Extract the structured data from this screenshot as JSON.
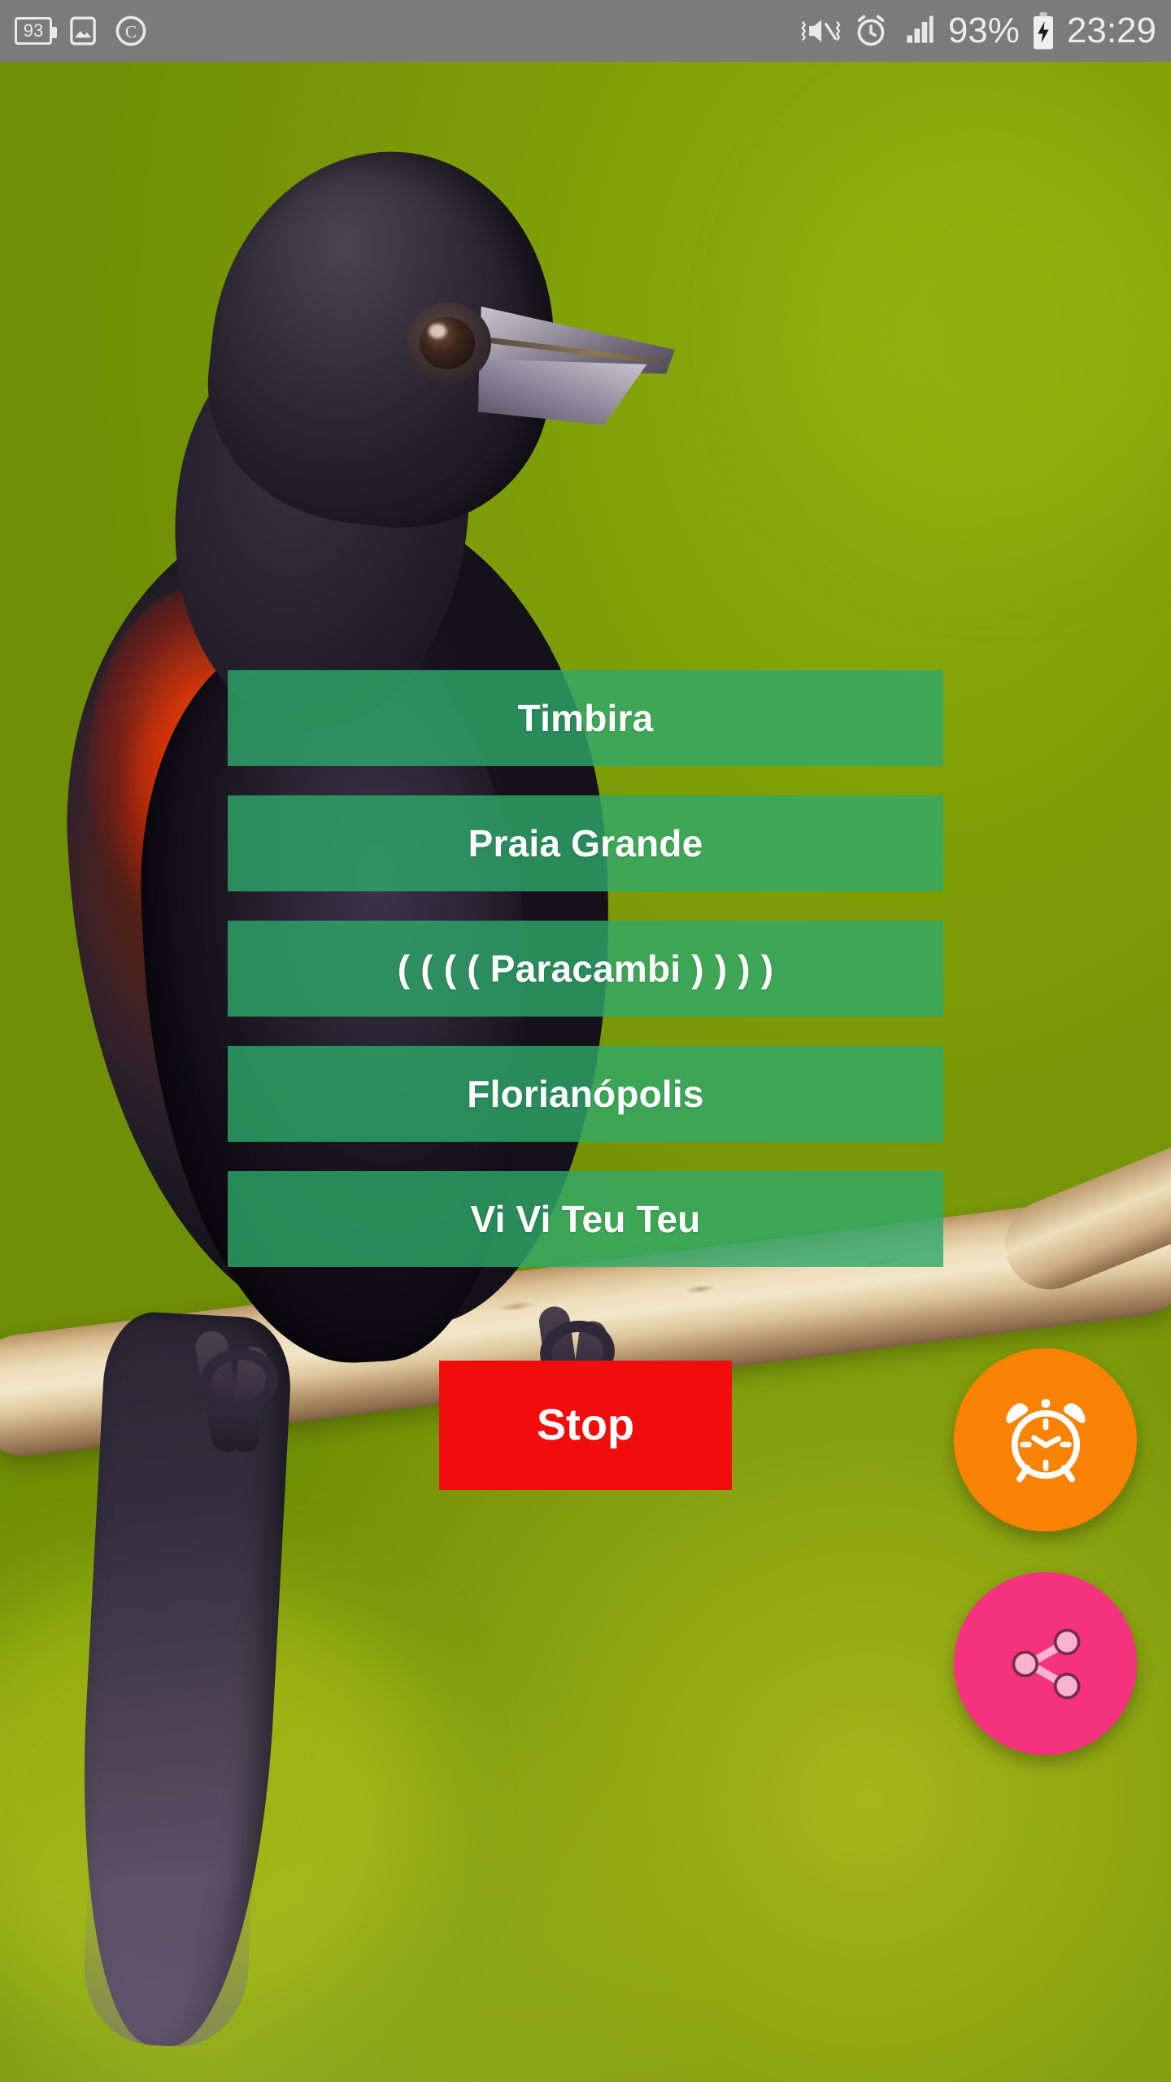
{
  "status_bar": {
    "battery_saver_level": "93",
    "icons_left": [
      "battery-number-icon",
      "photo-icon",
      "copyright-icon"
    ],
    "icons_right": [
      "mute-vibrate-icon",
      "alarm-clock-icon",
      "signal-bars-icon",
      "battery-charging-icon"
    ],
    "battery_percent": "93%",
    "time": "23:29",
    "background_color": "#7b7b7b",
    "text_color": "#ececec"
  },
  "app": {
    "background_image_description": "Black bird with red-orange breast perched on a branch against a green background",
    "button_color": "#2EA96A",
    "button_text_color": "#FFFFFF"
  },
  "track_list": {
    "items": [
      {
        "label": "Timbira",
        "playing": false
      },
      {
        "label": "Praia Grande",
        "playing": false
      },
      {
        "label": "( ( ( ( Paracambi ) ) ) )",
        "playing": true
      },
      {
        "label": "Florianópolis",
        "playing": false
      },
      {
        "label": "Vi Vi Teu Teu",
        "playing": false
      }
    ]
  },
  "controls": {
    "stop_label": "Stop",
    "stop_color": "#F20D0D",
    "alarm_fab": {
      "icon": "alarm-clock-icon",
      "color": "#FA8205"
    },
    "share_fab": {
      "icon": "share-icon",
      "color": "#F5327E"
    }
  }
}
